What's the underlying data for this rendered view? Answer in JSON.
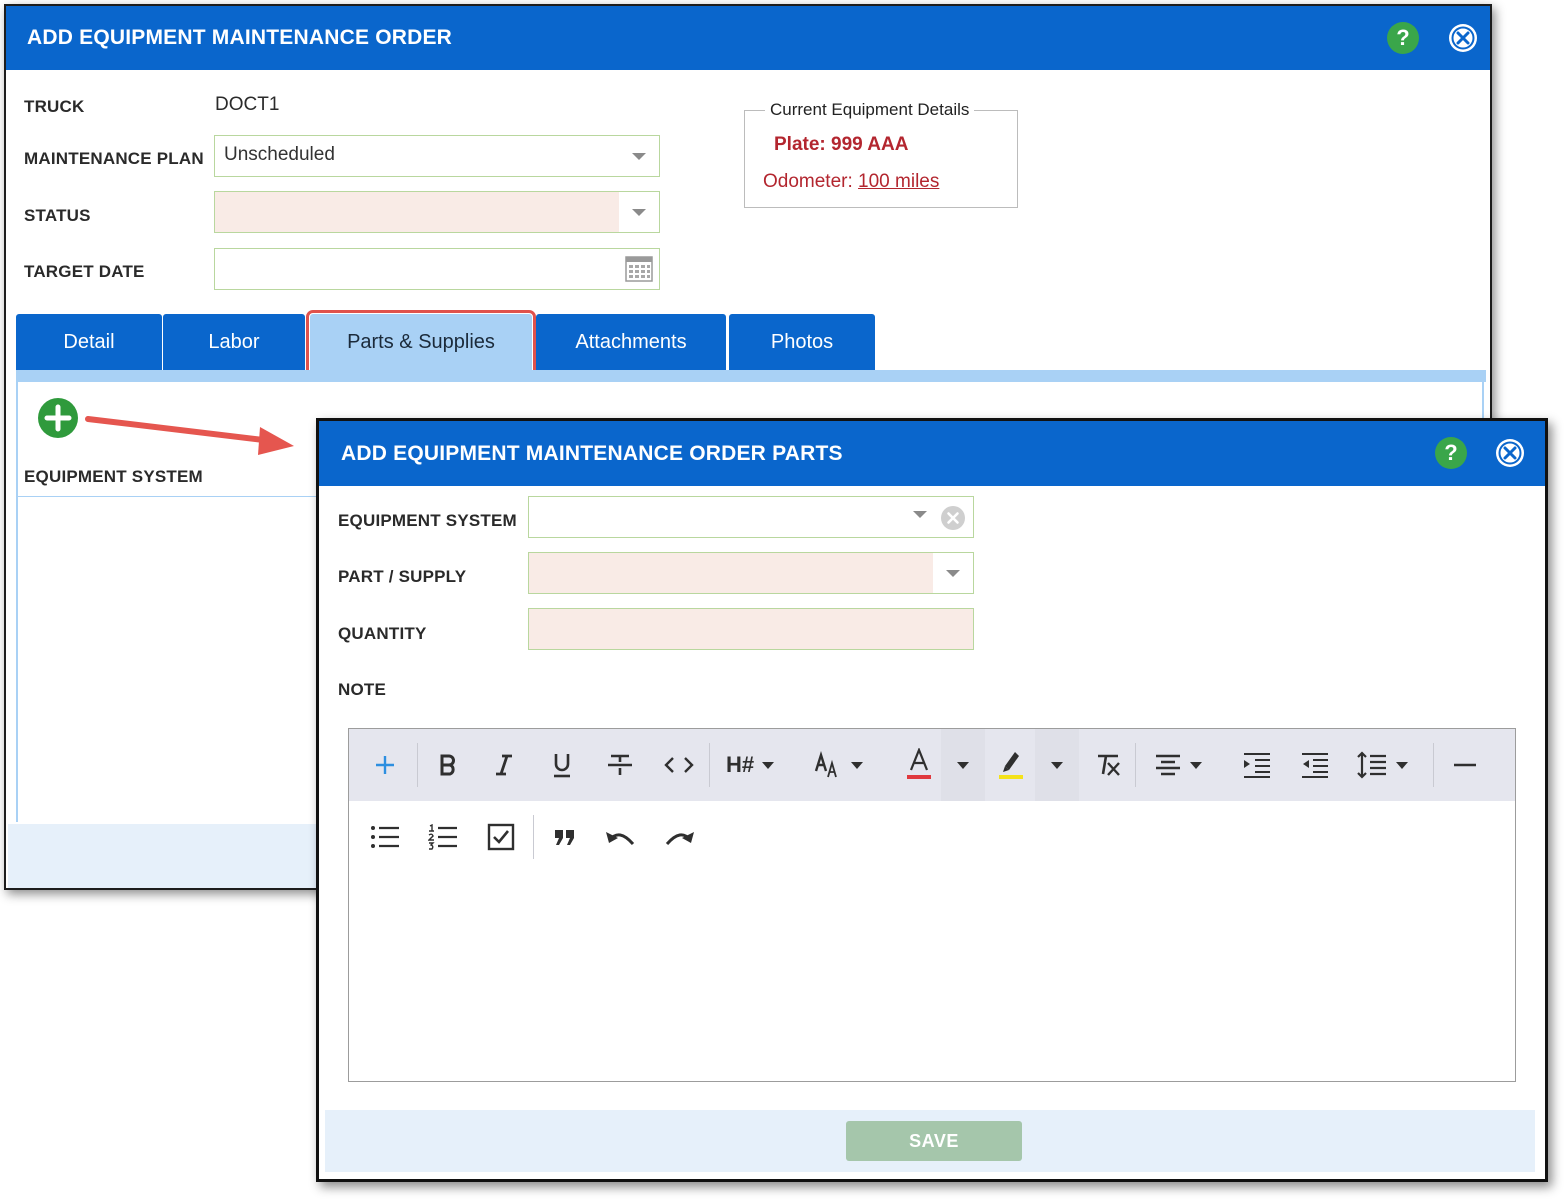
{
  "main_dialog": {
    "title": "ADD EQUIPMENT MAINTENANCE ORDER",
    "help_label": "?",
    "fields": {
      "truck_label": "TRUCK",
      "truck_value": "DOCT1",
      "plan_label": "MAINTENANCE PLAN",
      "plan_value": "Unscheduled",
      "status_label": "STATUS",
      "status_value": "",
      "target_date_label": "TARGET DATE",
      "target_date_value": ""
    },
    "equipment_details": {
      "legend": "Current Equipment Details",
      "plate": "Plate: 999 AAA",
      "odometer_label": "Odometer: ",
      "odometer_value": "100 miles"
    },
    "tabs": [
      {
        "label": "Detail"
      },
      {
        "label": "Labor"
      },
      {
        "label": "Parts & Supplies",
        "active": true
      },
      {
        "label": "Attachments"
      },
      {
        "label": "Photos"
      }
    ],
    "grid": {
      "column_header": "EQUIPMENT SYSTEM"
    }
  },
  "parts_dialog": {
    "title": "ADD EQUIPMENT MAINTENANCE ORDER PARTS",
    "help_label": "?",
    "fields": {
      "equipment_system_label": "EQUIPMENT SYSTEM",
      "equipment_system_value": "",
      "part_supply_label": "PART / SUPPLY",
      "part_supply_value": "",
      "quantity_label": "QUANTITY",
      "quantity_value": "",
      "note_label": "NOTE"
    },
    "toolbar": {
      "row1": [
        "add-icon",
        "bold-icon",
        "italic-icon",
        "underline-icon",
        "strikethrough-icon",
        "code-icon",
        "heading-icon",
        "font-size-icon",
        "font-color-icon",
        "highlight-icon",
        "clear-format-icon",
        "align-center-icon",
        "indent-icon",
        "outdent-icon",
        "line-height-icon",
        "horizontal-rule-icon"
      ],
      "row2": [
        "bullet-list-icon",
        "numbered-list-icon",
        "checklist-icon",
        "blockquote-icon",
        "undo-icon",
        "redo-icon"
      ],
      "heading_text": "H#"
    },
    "save_label": "SAVE"
  },
  "colors": {
    "titlebar": "#0a66cc",
    "tab_active": "#a9d1f5",
    "required_field": "#f9ebe6",
    "highlight_outline": "#e0524c",
    "detail_text": "#b3262f",
    "save_disabled": "#a5c6ab"
  }
}
